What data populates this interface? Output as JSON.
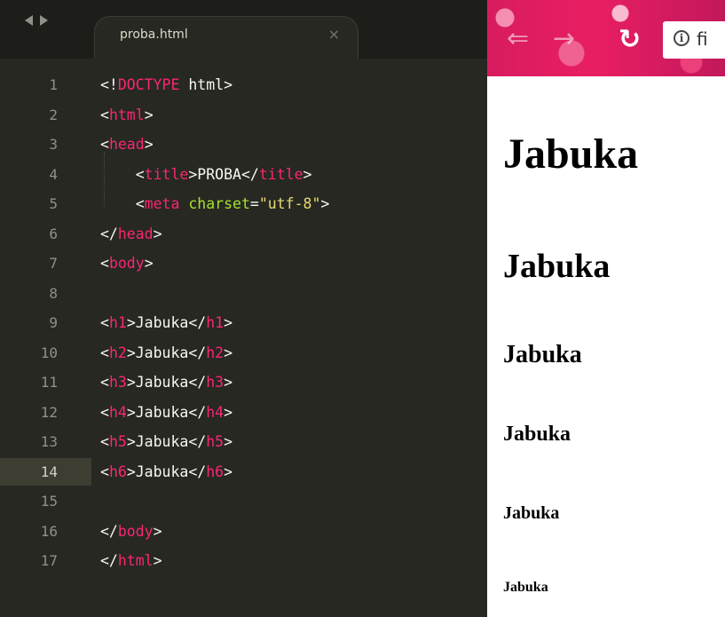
{
  "editor": {
    "tab": {
      "title": "proba.html",
      "close": "×"
    },
    "active_line": 14,
    "lines": [
      {
        "no": "1",
        "html": "&lt;!<span class=\"kw\">DOCTYPE</span> html&gt;"
      },
      {
        "no": "2",
        "html": "&lt;<span class=\"tag\">html</span>&gt;"
      },
      {
        "no": "3",
        "html": "&lt;<span class=\"tag\">head</span>&gt;"
      },
      {
        "no": "4",
        "html": "    &lt;<span class=\"tag\">title</span>&gt;PROBA&lt;/<span class=\"tag\">title</span>&gt;"
      },
      {
        "no": "5",
        "html": "    &lt;<span class=\"tag\">meta</span> <span class=\"attr\">charset</span>=<span class=\"str\">\"utf-8\"</span>&gt;"
      },
      {
        "no": "6",
        "html": "&lt;/<span class=\"tag\">head</span>&gt;"
      },
      {
        "no": "7",
        "html": "&lt;<span class=\"tag\">body</span>&gt;"
      },
      {
        "no": "8",
        "html": ""
      },
      {
        "no": "9",
        "html": "&lt;<span class=\"tag\">h1</span>&gt;Jabuka&lt;/<span class=\"tag\">h1</span>&gt;"
      },
      {
        "no": "10",
        "html": "&lt;<span class=\"tag\">h2</span>&gt;Jabuka&lt;/<span class=\"tag\">h2</span>&gt;"
      },
      {
        "no": "11",
        "html": "&lt;<span class=\"tag\">h3</span>&gt;Jabuka&lt;/<span class=\"tag\">h3</span>&gt;"
      },
      {
        "no": "12",
        "html": "&lt;<span class=\"tag\">h4</span>&gt;Jabuka&lt;/<span class=\"tag\">h4</span>&gt;"
      },
      {
        "no": "13",
        "html": "&lt;<span class=\"tag\">h5</span>&gt;Jabuka&lt;/<span class=\"tag\">h5</span>&gt;"
      },
      {
        "no": "14",
        "html": "&lt;<span class=\"tag\">h6</span>&gt;Jabuka&lt;/<span class=\"tag\">h6</span>&gt;"
      },
      {
        "no": "15",
        "html": ""
      },
      {
        "no": "16",
        "html": "&lt;/<span class=\"tag\">body</span>&gt;"
      },
      {
        "no": "17",
        "html": "&lt;/<span class=\"tag\">html</span>&gt;"
      }
    ],
    "colors": {
      "background": "#272822",
      "tag": "#f92672",
      "attribute": "#a6e22e",
      "string": "#e6db74",
      "text": "#f8f8f2",
      "gutter": "#8f908a"
    },
    "icons": {
      "back": "left-triangle-icon",
      "forward": "right-triangle-icon"
    }
  },
  "browser": {
    "url_partial": "fi",
    "icons": {
      "back": "back-arrow-icon",
      "forward": "forward-arrow-icon",
      "reload": "reload-icon",
      "info": "info-icon"
    },
    "headings": {
      "h1": "Jabuka",
      "h2": "Jabuka",
      "h3": "Jabuka",
      "h4": "Jabuka",
      "h5": "Jabuka",
      "h6": "Jabuka"
    },
    "colors": {
      "toolbar": "#e91e63"
    }
  }
}
